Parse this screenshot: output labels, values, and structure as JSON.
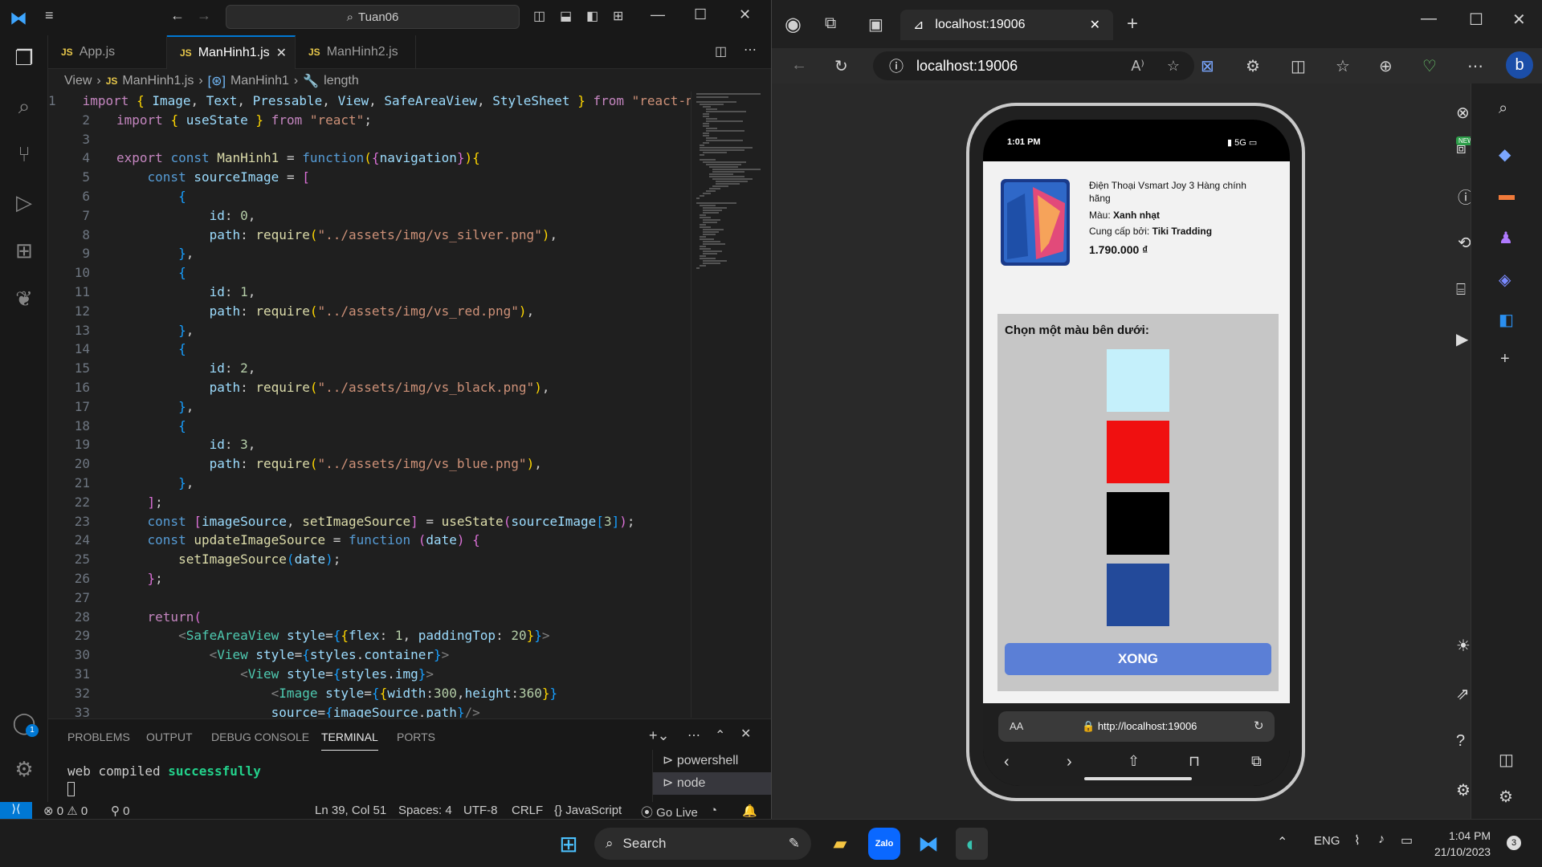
{
  "vscode": {
    "search_text": "Tuan06",
    "tabs": [
      "App.js",
      "ManHinh1.js",
      "ManHinh2.js"
    ],
    "tab_badge": "JS",
    "breadcrumb": [
      "View",
      "ManHinh1.js",
      "ManHinh1",
      "length"
    ],
    "line_numbers": [
      "1",
      "2",
      "3",
      "4",
      "5",
      "6",
      "7",
      "8",
      "9",
      "10",
      "11",
      "12",
      "13",
      "14",
      "15",
      "16",
      "17",
      "18",
      "19",
      "20",
      "21",
      "22",
      "23",
      "24",
      "25",
      "26",
      "27",
      "28",
      "29",
      "30",
      "31",
      "32",
      "33"
    ],
    "panel_tabs": [
      "PROBLEMS",
      "OUTPUT",
      "DEBUG CONSOLE",
      "TERMINAL",
      "PORTS"
    ],
    "terminal_text": "web compiled",
    "terminal_success": "successfully",
    "terminals": [
      "powershell",
      "node"
    ],
    "status": {
      "errors": "0",
      "warnings": "0",
      "ports": "0",
      "position": "Ln 39, Col 51",
      "spaces": "Spaces: 4",
      "encoding": "UTF-8",
      "eol": "CRLF",
      "language": "JavaScript",
      "golive": "Go Live"
    },
    "account_badge": "1"
  },
  "edge": {
    "tab_title": "localhost:19006",
    "address": "localhost:19006",
    "new_badge": "NEW"
  },
  "phone": {
    "time": "1:01 PM",
    "signal": "5G",
    "product_name": "Điện Thoại Vsmart Joy 3 Hàng chính hãng",
    "color_label": "Màu:",
    "color_value": "Xanh nhạt",
    "supplier_label": "Cung cấp bởi:",
    "supplier_value": "Tiki Tradding",
    "price": "1.790.000 ₫",
    "choose_label": "Chọn một màu bên dưới:",
    "swatches": [
      "#c5f0fb",
      "#f01010",
      "#000000",
      "#234a9a"
    ],
    "done_label": "XONG",
    "safari_aa": "AA",
    "safari_url": "http://localhost:19006"
  },
  "taskbar": {
    "search_label": "Search",
    "lang": "ENG",
    "time": "1:04 PM",
    "date": "21/10/2023",
    "notif_count": "3"
  }
}
